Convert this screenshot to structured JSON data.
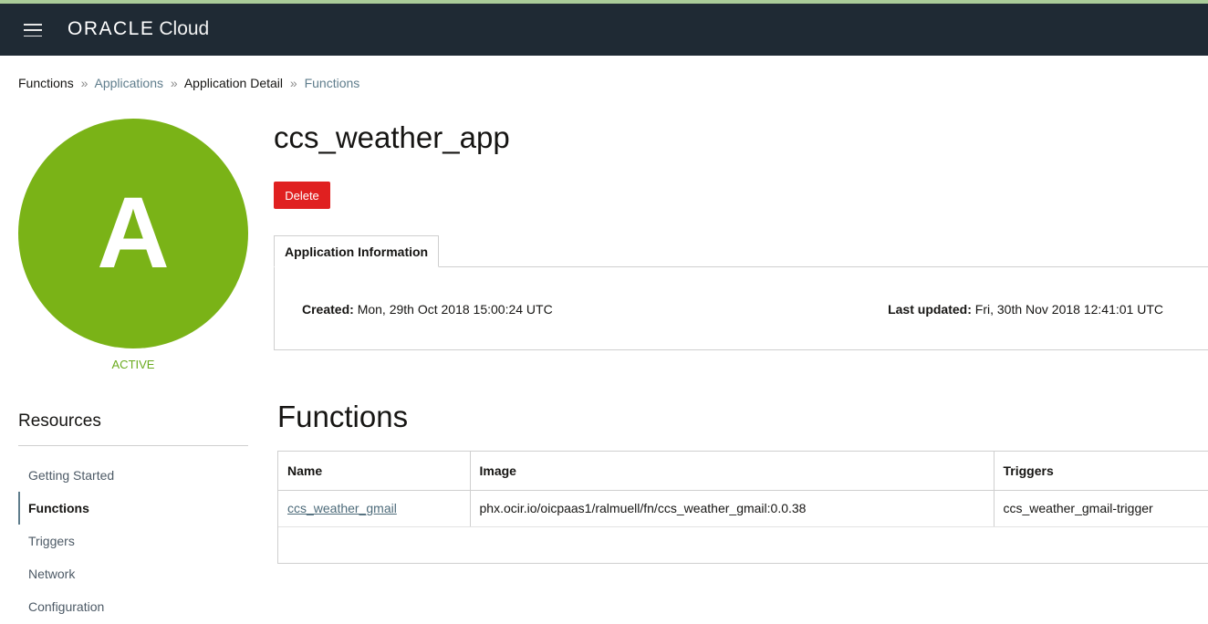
{
  "colors": {
    "topbar_bg": "#1f2a34",
    "active_green": "#7ab317",
    "status_green": "#6aab1e",
    "danger_red": "#e02020",
    "link": "#5f7d8c"
  },
  "header": {
    "logo_text": "ORACLE",
    "product_text": "Cloud"
  },
  "breadcrumb": {
    "items": [
      "Functions",
      "Applications",
      "Application Detail",
      "Functions"
    ],
    "separator": "»"
  },
  "app": {
    "avatar_letter": "A",
    "status": "ACTIVE",
    "title": "ccs_weather_app",
    "delete_label": "Delete"
  },
  "resources": {
    "title": "Resources",
    "items": [
      "Getting Started",
      "Functions",
      "Triggers",
      "Network",
      "Configuration"
    ],
    "active_item": "Functions"
  },
  "info": {
    "tab_label": "Application Information",
    "created_label": "Created:",
    "created_value": "Mon, 29th Oct 2018 15:00:24 UTC",
    "updated_label": "Last updated:",
    "updated_value": "Fri, 30th Nov 2018 12:41:01 UTC"
  },
  "functions": {
    "title": "Functions",
    "columns": [
      "Name",
      "Image",
      "Triggers"
    ],
    "rows": [
      {
        "name": "ccs_weather_gmail",
        "image": "phx.ocir.io/oicpaas1/ralmuell/fn/ccs_weather_gmail:0.0.38",
        "triggers": "ccs_weather_gmail-trigger"
      }
    ]
  }
}
